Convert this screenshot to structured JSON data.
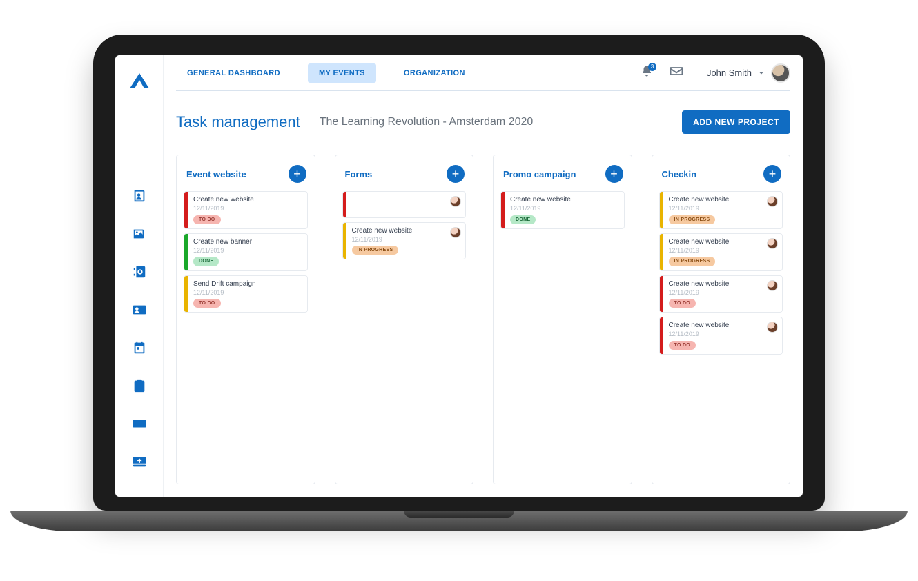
{
  "nav": {
    "general": "GENERAL DASHBOARD",
    "events": "MY EVENTS",
    "org": "ORGANIZATION",
    "notif_count": "3",
    "user_name": "John Smith"
  },
  "header": {
    "title": "Task management",
    "subtitle": "The Learning Revolution - Amsterdam 2020",
    "add_btn": "ADD NEW PROJECT"
  },
  "status_labels": {
    "todo": "TO DO",
    "done": "DONE",
    "inprogress": "IN PROGRESS"
  },
  "columns": [
    {
      "title": "Event website",
      "cards": [
        {
          "title": "Create new website",
          "date": "12/11/2019",
          "status": "todo",
          "stripe": "red",
          "assignee": false
        },
        {
          "title": "Create new banner",
          "date": "12/11/2019",
          "status": "done",
          "stripe": "green",
          "assignee": false
        },
        {
          "title": "Send Drift campaign",
          "date": "12/11/2019",
          "status": "todo",
          "stripe": "amber",
          "assignee": false
        }
      ]
    },
    {
      "title": "Forms",
      "cards": [
        {
          "title": "",
          "date": "",
          "status": "",
          "stripe": "red",
          "assignee": true
        },
        {
          "title": "Create new website",
          "date": "12/11/2019",
          "status": "inprogress",
          "stripe": "amber",
          "assignee": true
        }
      ]
    },
    {
      "title": "Promo campaign",
      "cards": [
        {
          "title": "Create new website",
          "date": "12/11/2019",
          "status": "done",
          "stripe": "red",
          "assignee": false
        }
      ]
    },
    {
      "title": "Checkin",
      "cards": [
        {
          "title": "Create new website",
          "date": "12/11/2019",
          "status": "inprogress",
          "stripe": "amber",
          "assignee": true
        },
        {
          "title": "Create new website",
          "date": "12/11/2019",
          "status": "inprogress",
          "stripe": "amber",
          "assignee": true
        },
        {
          "title": "Create new website",
          "date": "12/11/2019",
          "status": "todo",
          "stripe": "red",
          "assignee": true
        },
        {
          "title": "Create new website",
          "date": "12/11/2019",
          "status": "todo",
          "stripe": "red",
          "assignee": true
        }
      ]
    }
  ]
}
